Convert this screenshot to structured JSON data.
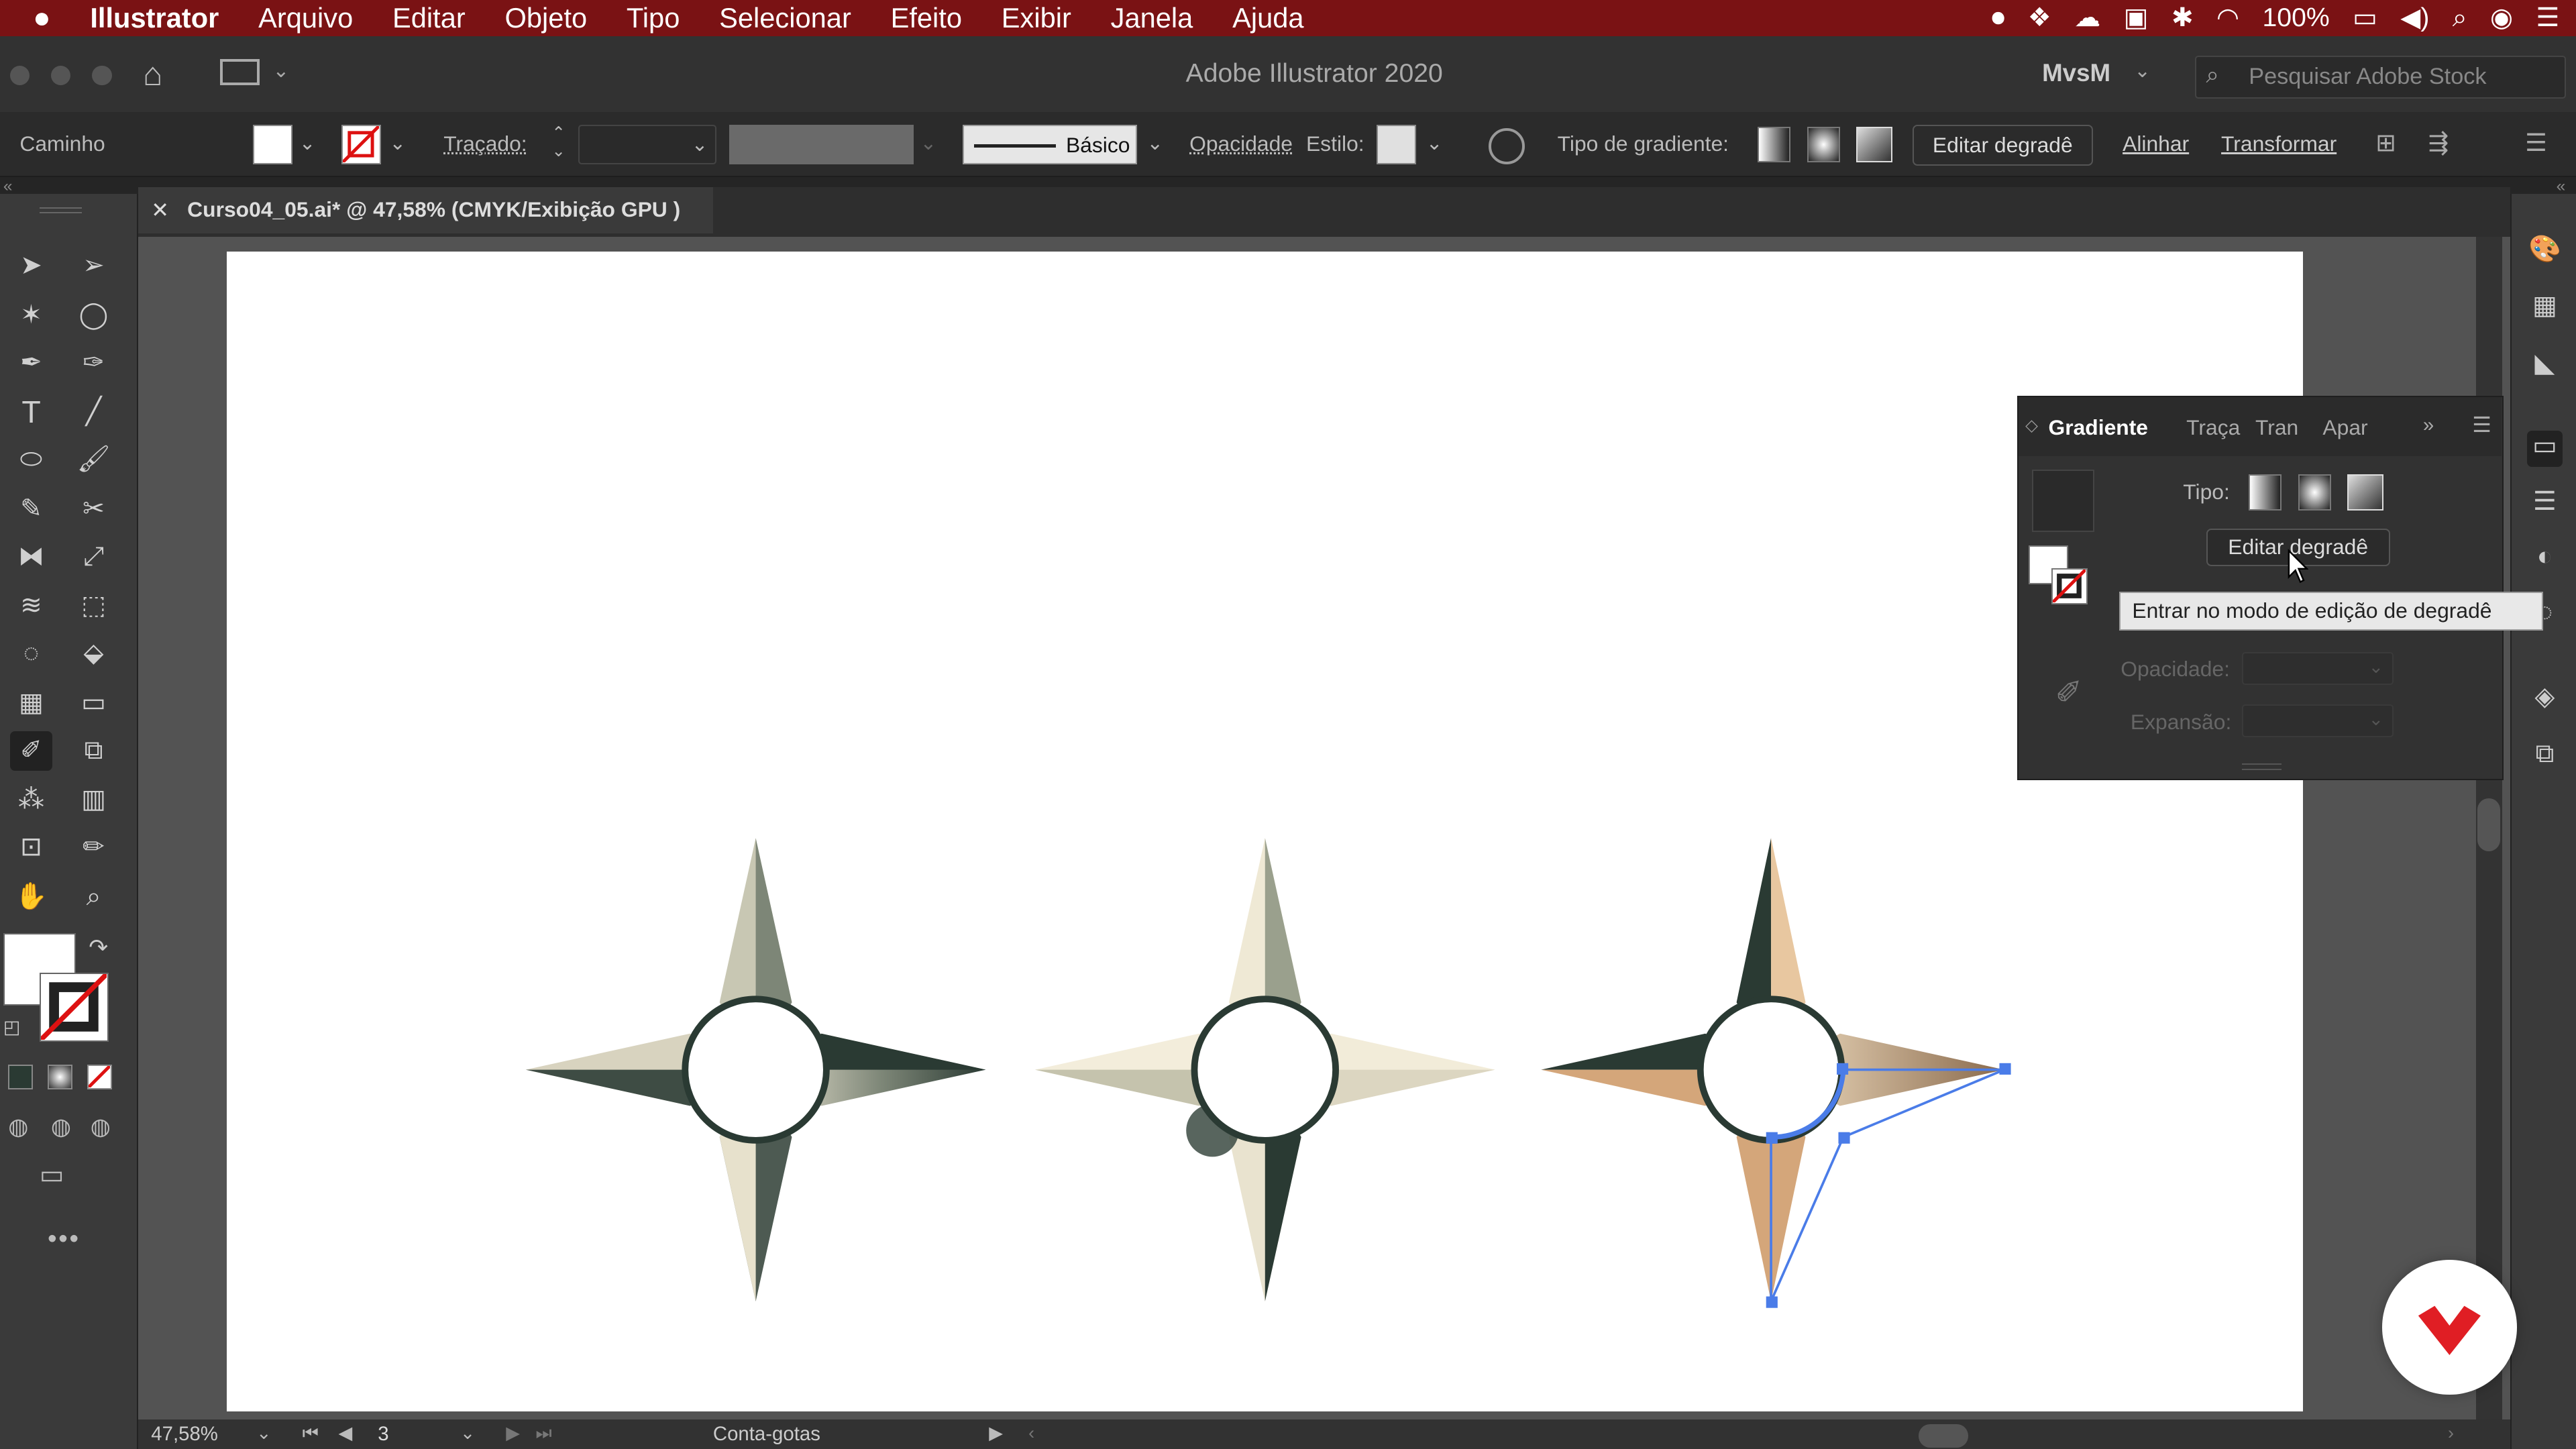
{
  "macbar": {
    "apple": "",
    "app": "Illustrator",
    "menus": [
      "Arquivo",
      "Editar",
      "Objeto",
      "Tipo",
      "Selecionar",
      "Efeito",
      "Exibir",
      "Janela",
      "Ajuda"
    ],
    "battery": "100%"
  },
  "titlebar": {
    "title": "Adobe Illustrator 2020",
    "workspace": "MvsM",
    "search_placeholder": "Pesquisar Adobe Stock"
  },
  "controlbar": {
    "selection_label": "Caminho",
    "stroke_label": "Traçado:",
    "brush_label": "Básico",
    "opacity_label": "Opacidade",
    "style_label": "Estilo:",
    "gradient_type_label": "Tipo de gradiente:",
    "edit_gradient": "Editar degradê",
    "align": "Alinhar",
    "transform": "Transformar"
  },
  "document": {
    "tab_title": "Curso04_05.ai* @ 47,58% (CMYK/Exibição GPU )"
  },
  "gradient_panel": {
    "tabs": [
      "Gradiente",
      "Traça",
      "Tran",
      "Apar"
    ],
    "type_label": "Tipo:",
    "edit_button": "Editar degradê",
    "opacity_label": "Opacidade:",
    "expansion_label": "Expansão:"
  },
  "tooltip": "Entrar no modo de edição de degradê",
  "statusbar": {
    "zoom": "47,58%",
    "artboard": "3",
    "tool": "Conta-gotas"
  },
  "colors": {
    "menubar": "#7a1214",
    "star_dark": "#2a3a33",
    "star_light": "#eee8d6",
    "star_tan": "#d4a67a",
    "selection": "#4a7ce8"
  }
}
